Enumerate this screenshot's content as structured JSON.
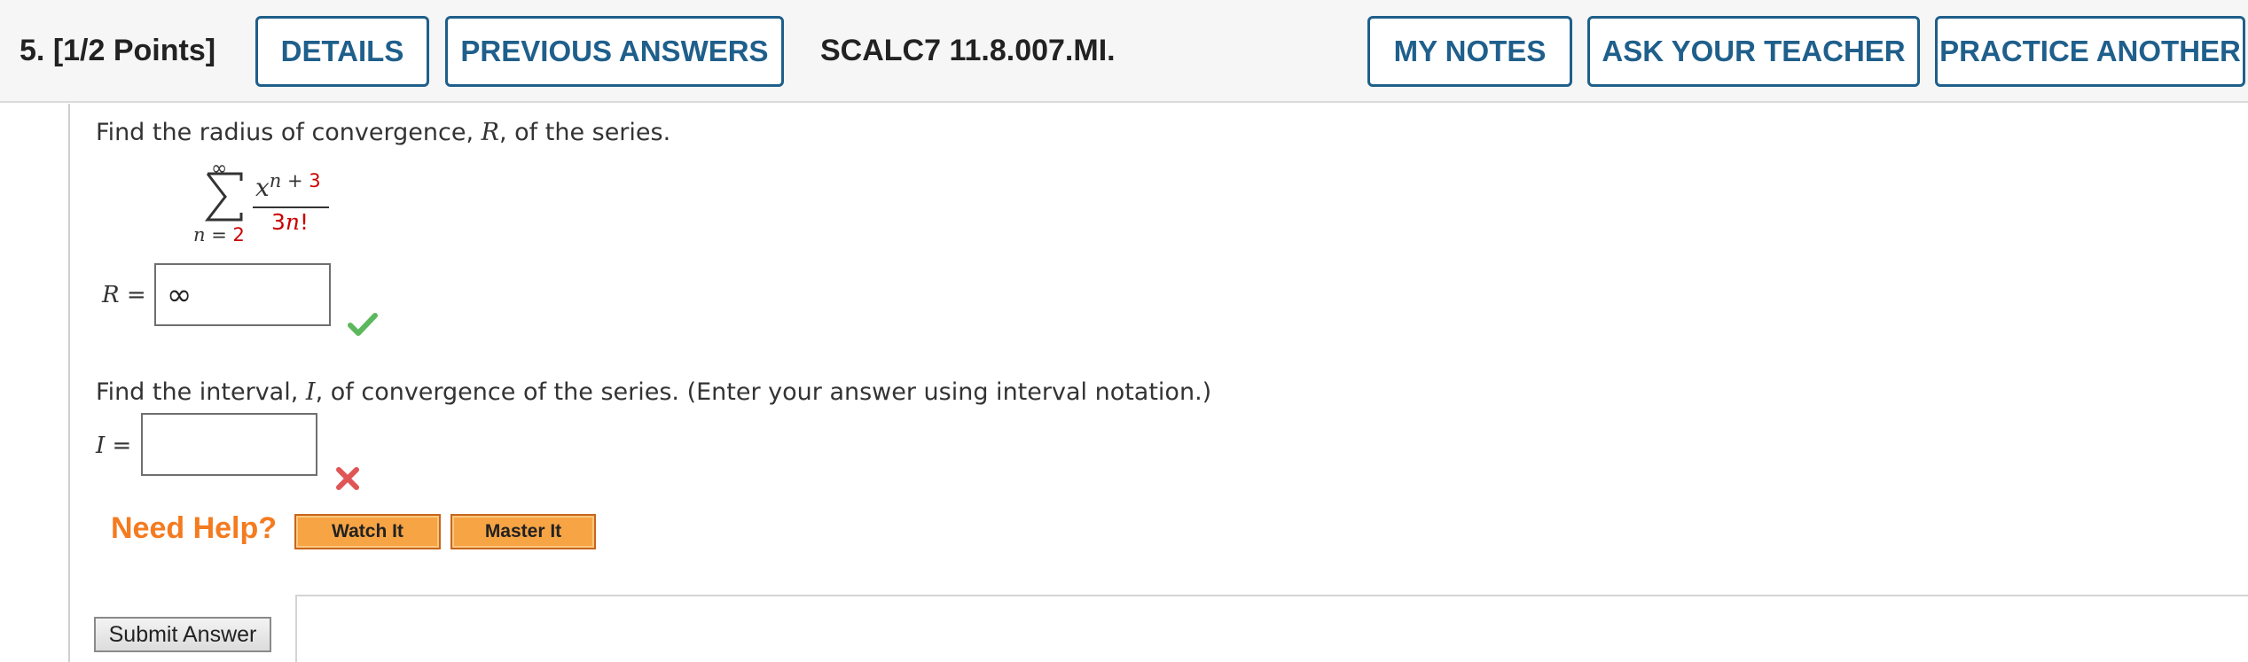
{
  "header": {
    "question_number": "5.",
    "points": "[1/2 Points]",
    "details_label": "DETAILS",
    "previous_answers_label": "PREVIOUS ANSWERS",
    "question_id": "SCALC7 11.8.007.MI.",
    "my_notes_label": "MY NOTES",
    "ask_teacher_label": "ASK YOUR TEACHER",
    "practice_another_label": "PRACTICE ANOTHER"
  },
  "question": {
    "part1_prompt_a": "Find the radius of convergence, ",
    "part1_prompt_var": "R",
    "part1_prompt_b": ", of the series.",
    "series": {
      "upper_limit": "∞",
      "lower_var": "n",
      "lower_eq": " = ",
      "lower_value": "2",
      "numerator_base": "x",
      "numerator_exp_var": "n",
      "numerator_exp_op": " + ",
      "numerator_exp_const": "3",
      "denominator_coef": "3",
      "denominator_var": "n",
      "denominator_fact": "!"
    },
    "r_label_var": "R",
    "r_label_eq": " =",
    "r_answer": "∞",
    "r_status": "correct",
    "part2_prompt_a": "Find the interval, ",
    "part2_prompt_var": "I",
    "part2_prompt_b": ", of convergence of the series. (Enter your answer using interval notation.)",
    "i_label_var": "I",
    "i_label_eq": " =",
    "i_answer": "",
    "i_status": "incorrect"
  },
  "help": {
    "label": "Need Help?",
    "watch_label": "Watch It",
    "master_label": "Master It"
  },
  "submit_label": "Submit Answer",
  "colors": {
    "accent_blue": "#1f5f8b",
    "correct_green": "#5cb85c",
    "incorrect_red": "#e05555",
    "help_orange": "#f47b20",
    "math_red": "#cc0000"
  }
}
